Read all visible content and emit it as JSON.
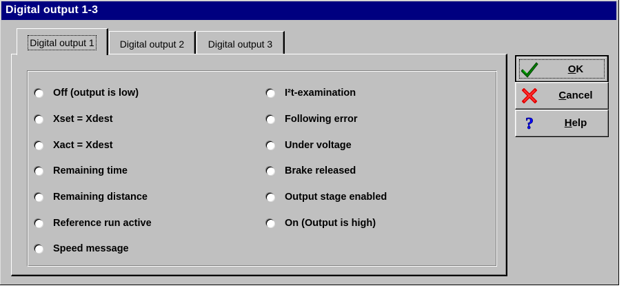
{
  "window": {
    "title": "Digital output 1-3"
  },
  "tabs": [
    {
      "label": "Digital output 1",
      "active": true
    },
    {
      "label": "Digital output 2",
      "active": false
    },
    {
      "label": "Digital output 3",
      "active": false
    }
  ],
  "options_left": [
    "Off (output is low)",
    "Xset = Xdest",
    "Xact = Xdest",
    "Remaining time",
    "Remaining distance",
    "Reference run active",
    "Speed message"
  ],
  "options_right": [
    "I²t-examination",
    "Following error",
    "Under voltage",
    "Brake released",
    "Output stage enabled",
    "On (Output is high)"
  ],
  "buttons": {
    "ok": {
      "mnemonic": "O",
      "rest": "K",
      "icon": "checkmark-icon",
      "color": "#008000"
    },
    "cancel": {
      "mnemonic": "C",
      "rest": "ancel",
      "icon": "red-x-icon",
      "color": "#ff0000"
    },
    "help": {
      "mnemonic": "H",
      "rest": "elp",
      "icon": "question-mark-icon",
      "color": "#0000ff"
    }
  },
  "colors": {
    "titlebar": "#000080",
    "face": "#c0c0c0"
  }
}
